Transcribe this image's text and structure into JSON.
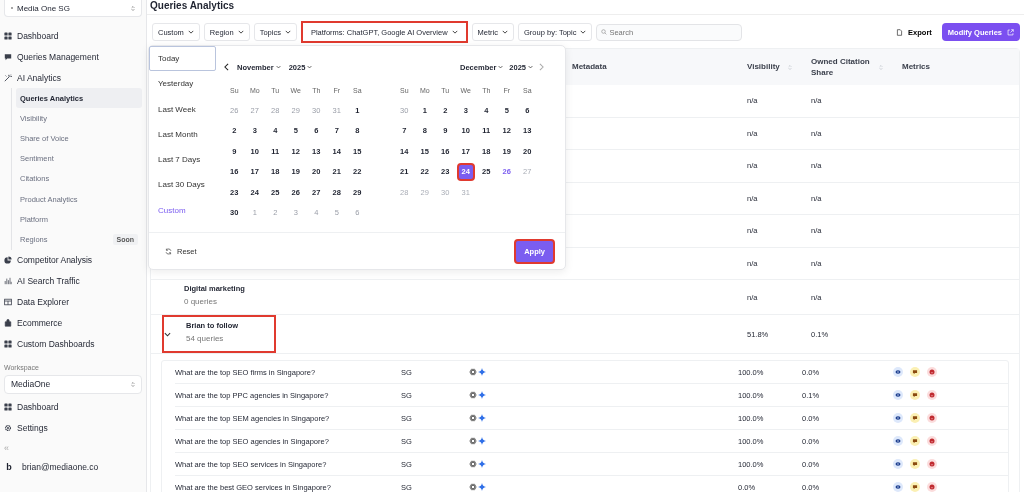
{
  "sidebar": {
    "org_selector": "Media One SG",
    "nav": [
      {
        "label": "Dashboard"
      },
      {
        "label": "Queries Management"
      },
      {
        "label": "AI Analytics",
        "children": [
          {
            "label": "Queries Analytics",
            "selected": true
          },
          {
            "label": "Visibility",
            "selected": false
          },
          {
            "label": "Share of Voice",
            "selected": false
          },
          {
            "label": "Sentiment",
            "selected": false
          },
          {
            "label": "Citations",
            "selected": false
          },
          {
            "label": "Product Analytics",
            "selected": false
          },
          {
            "label": "Platform",
            "selected": false
          },
          {
            "label": "Regions",
            "selected": false,
            "badge": "Soon"
          }
        ]
      },
      {
        "label": "Competitor Analysis"
      },
      {
        "label": "AI Search Traffic"
      },
      {
        "label": "Data Explorer"
      },
      {
        "label": "Ecommerce"
      },
      {
        "label": "Custom Dashboards"
      }
    ],
    "workspace_label": "Workspace",
    "workspace_selector": "MediaOne",
    "workspace_nav": [
      {
        "label": "Dashboard"
      },
      {
        "label": "Settings"
      }
    ],
    "collapse": "«",
    "user_initial": "b",
    "user_email": "brian@mediaone.co"
  },
  "page_title": "Queries Analytics",
  "filters": [
    {
      "label": "Custom",
      "highlighted": false
    },
    {
      "label": "Region",
      "highlighted": false
    },
    {
      "label": "Topics",
      "highlighted": false
    },
    {
      "label": "Platforms: ChatGPT, Google AI Overview",
      "highlighted": true
    },
    {
      "label": "Metric",
      "highlighted": false
    },
    {
      "label": "Group by: Topic",
      "highlighted": false
    }
  ],
  "search": {
    "placeholder": "Search"
  },
  "export_button": "Export",
  "modify_button": "Modify Queries",
  "table": {
    "columns": [
      {
        "label": "Metadata",
        "sortable": false
      },
      {
        "label": "Visibility",
        "sortable": true
      },
      {
        "label": "Owned Citation Share",
        "sortable": true
      },
      {
        "label": "Metrics",
        "sortable": false
      }
    ],
    "groups": [
      {
        "visibility": "n/a",
        "citation_share": "n/a"
      },
      {
        "visibility": "n/a",
        "citation_share": "n/a"
      },
      {
        "visibility": "n/a",
        "citation_share": "n/a"
      },
      {
        "visibility": "n/a",
        "citation_share": "n/a"
      },
      {
        "visibility": "n/a",
        "citation_share": "n/a"
      },
      {
        "visibility": "n/a",
        "citation_share": "n/a"
      },
      {
        "name": "Digital marketing",
        "count": "0 queries",
        "visibility": "n/a",
        "citation_share": "n/a"
      },
      {
        "name": "Brian to follow",
        "count": "54 queries",
        "visibility": "51.8%",
        "citation_share": "0.1%",
        "expanded": true,
        "highlighted": true,
        "queries": [
          {
            "query": "What are the top SEO firms in Singapore?",
            "region": "SG",
            "visibility": "100.0%",
            "citation_share": "0.0%"
          },
          {
            "query": "What are the top PPC agencies in Singapore?",
            "region": "SG",
            "visibility": "100.0%",
            "citation_share": "0.1%"
          },
          {
            "query": "What are the top SEM agencies in Singapore?",
            "region": "SG",
            "visibility": "100.0%",
            "citation_share": "0.0%"
          },
          {
            "query": "What are the top SEO agencies in Singapore?",
            "region": "SG",
            "visibility": "100.0%",
            "citation_share": "0.0%"
          },
          {
            "query": "What are the top SEO services in Singapore?",
            "region": "SG",
            "visibility": "100.0%",
            "citation_share": "0.0%"
          },
          {
            "query": "What are the best GEO services in Singapore?",
            "region": "SG",
            "visibility": "0.0%",
            "citation_share": "0.0%"
          }
        ]
      }
    ]
  },
  "date_picker": {
    "presets": [
      {
        "label": "Today",
        "selected": false,
        "focused": true
      },
      {
        "label": "Yesterday",
        "selected": false,
        "focused": false
      },
      {
        "label": "Last Week",
        "selected": false,
        "focused": false
      },
      {
        "label": "Last Month",
        "selected": false,
        "focused": false
      },
      {
        "label": "Last 7 Days",
        "selected": false,
        "focused": false
      },
      {
        "label": "Last 30 Days",
        "selected": false,
        "focused": false
      },
      {
        "label": "Custom",
        "selected": true,
        "focused": false
      }
    ],
    "months": [
      {
        "month": "November",
        "year": "2025",
        "weekdays": [
          "Su",
          "Mo",
          "Tu",
          "We",
          "Th",
          "Fr",
          "Sa"
        ],
        "days": [
          {
            "label": "26",
            "kind": "adjacent"
          },
          {
            "label": "27",
            "kind": "adjacent"
          },
          {
            "label": "28",
            "kind": "adjacent"
          },
          {
            "label": "29",
            "kind": "adjacent"
          },
          {
            "label": "30",
            "kind": "adjacent"
          },
          {
            "label": "31",
            "kind": "adjacent"
          },
          {
            "label": "1",
            "kind": "current"
          },
          {
            "label": "2",
            "kind": "current"
          },
          {
            "label": "3",
            "kind": "current"
          },
          {
            "label": "4",
            "kind": "current"
          },
          {
            "label": "5",
            "kind": "current"
          },
          {
            "label": "6",
            "kind": "current"
          },
          {
            "label": "7",
            "kind": "current"
          },
          {
            "label": "8",
            "kind": "current"
          },
          {
            "label": "9",
            "kind": "current"
          },
          {
            "label": "10",
            "kind": "current"
          },
          {
            "label": "11",
            "kind": "current"
          },
          {
            "label": "12",
            "kind": "current"
          },
          {
            "label": "13",
            "kind": "current"
          },
          {
            "label": "14",
            "kind": "current"
          },
          {
            "label": "15",
            "kind": "current"
          },
          {
            "label": "16",
            "kind": "current"
          },
          {
            "label": "17",
            "kind": "current"
          },
          {
            "label": "18",
            "kind": "current"
          },
          {
            "label": "19",
            "kind": "current"
          },
          {
            "label": "20",
            "kind": "current"
          },
          {
            "label": "21",
            "kind": "current"
          },
          {
            "label": "22",
            "kind": "current"
          },
          {
            "label": "23",
            "kind": "current"
          },
          {
            "label": "24",
            "kind": "current"
          },
          {
            "label": "25",
            "kind": "current"
          },
          {
            "label": "26",
            "kind": "current"
          },
          {
            "label": "27",
            "kind": "current"
          },
          {
            "label": "28",
            "kind": "current"
          },
          {
            "label": "29",
            "kind": "current"
          },
          {
            "label": "30",
            "kind": "current"
          },
          {
            "label": "1",
            "kind": "adjacent"
          },
          {
            "label": "2",
            "kind": "adjacent"
          },
          {
            "label": "3",
            "kind": "adjacent"
          },
          {
            "label": "4",
            "kind": "adjacent"
          },
          {
            "label": "5",
            "kind": "adjacent"
          },
          {
            "label": "6",
            "kind": "adjacent"
          }
        ]
      },
      {
        "month": "December",
        "year": "2025",
        "weekdays": [
          "Su",
          "Mo",
          "Tu",
          "We",
          "Th",
          "Fr",
          "Sa"
        ],
        "days": [
          {
            "label": "30",
            "kind": "adjacent"
          },
          {
            "label": "1",
            "kind": "current"
          },
          {
            "label": "2",
            "kind": "current"
          },
          {
            "label": "3",
            "kind": "current"
          },
          {
            "label": "4",
            "kind": "current"
          },
          {
            "label": "5",
            "kind": "current"
          },
          {
            "label": "6",
            "kind": "current"
          },
          {
            "label": "7",
            "kind": "current"
          },
          {
            "label": "8",
            "kind": "current"
          },
          {
            "label": "9",
            "kind": "current"
          },
          {
            "label": "10",
            "kind": "current"
          },
          {
            "label": "11",
            "kind": "current"
          },
          {
            "label": "12",
            "kind": "current"
          },
          {
            "label": "13",
            "kind": "current"
          },
          {
            "label": "14",
            "kind": "current"
          },
          {
            "label": "15",
            "kind": "current"
          },
          {
            "label": "16",
            "kind": "current"
          },
          {
            "label": "17",
            "kind": "current"
          },
          {
            "label": "18",
            "kind": "current"
          },
          {
            "label": "19",
            "kind": "current"
          },
          {
            "label": "20",
            "kind": "current"
          },
          {
            "label": "21",
            "kind": "current"
          },
          {
            "label": "22",
            "kind": "current"
          },
          {
            "label": "23",
            "kind": "current"
          },
          {
            "label": "24",
            "kind": "selected",
            "highlighted": true
          },
          {
            "label": "25",
            "kind": "current"
          },
          {
            "label": "26",
            "kind": "today"
          },
          {
            "label": "27",
            "kind": "disabled"
          },
          {
            "label": "28",
            "kind": "disabled"
          },
          {
            "label": "29",
            "kind": "disabled"
          },
          {
            "label": "30",
            "kind": "disabled"
          },
          {
            "label": "31",
            "kind": "disabled"
          }
        ]
      }
    ],
    "reset": "Reset",
    "apply": "Apply",
    "apply_highlighted": true
  }
}
